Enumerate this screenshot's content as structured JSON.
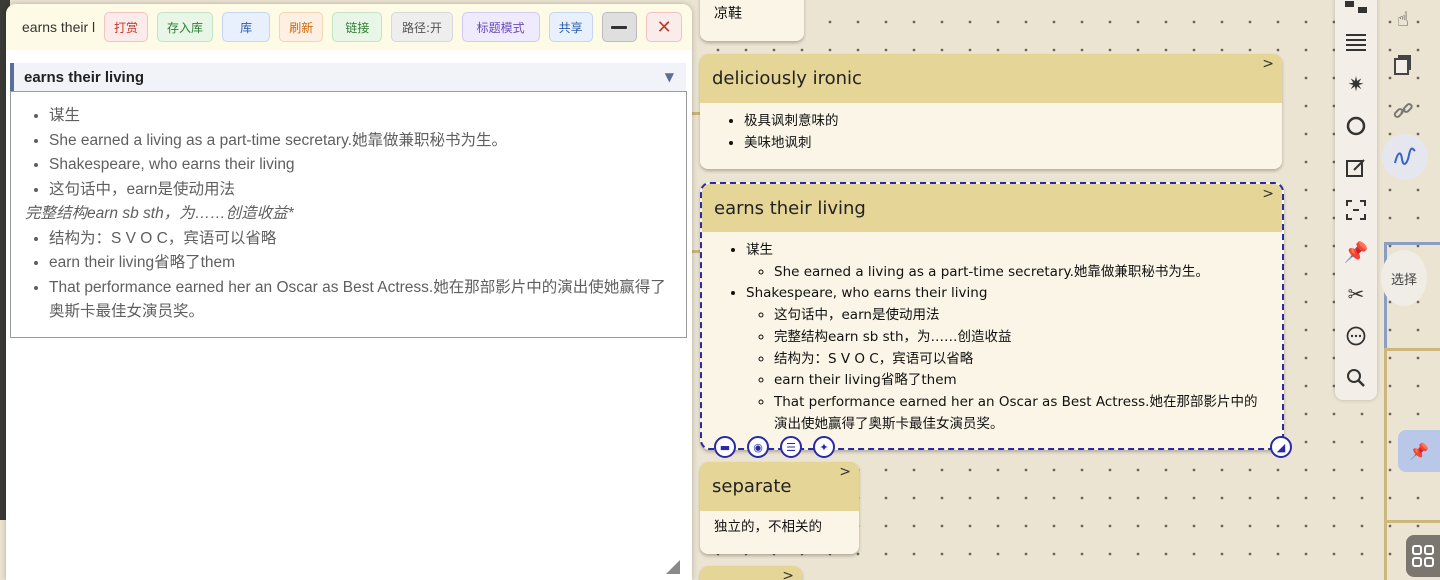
{
  "panel": {
    "title": "earns their l",
    "buttons": {
      "reward": "打赏",
      "save_to_library": "存入库",
      "library": "库",
      "refresh": "刷新",
      "link": "链接",
      "path": "路径:开",
      "title_mode": "标题模式",
      "share": "共享"
    },
    "topic_title": "earns their living",
    "toggle_symbol": "▼",
    "notes": [
      "谋生",
      "She earned a living as a part-time secretary.她靠做兼职秘书为生。",
      "Shakespeare, who earns their living",
      "这句话中，earn是使动用法"
    ],
    "italic_line": "完整结构earn sb sth，为……创造收益*",
    "notes_2": [
      "结构为：S V O C，宾语可以省略",
      "earn their living省略了them",
      "That performance earned her an Oscar as Best Actress.她在那部影片中的演出使她赢得了奥斯卡最佳女演员奖。"
    ]
  },
  "mindmap": {
    "card_top": {
      "text": "凉鞋"
    },
    "card_ironic": {
      "title": "deliciously ironic",
      "items": [
        "极具讽刺意味的",
        "美味地讽刺"
      ]
    },
    "card_earns": {
      "title": "earns their living",
      "item1": "谋生",
      "item1_sub": [
        "She earned a living as a part-time secretary.她靠做兼职秘书为生。"
      ],
      "item2": "Shakespeare, who earns their living",
      "item2_sub": [
        "这句话中，earn是使动用法",
        "完整结构earn sb sth，为……创造收益",
        "结构为：S V O C，宾语可以省略",
        "earn their living省略了them",
        "That performance earned her an Oscar as Best Actress.她在那部影片中的演出使她赢得了奥斯卡最佳女演员奖。"
      ]
    },
    "card_separate": {
      "title": "separate",
      "text": "独立的，不相关的"
    },
    "expand_symbol": ">"
  },
  "right_toolbar": {
    "icons": [
      "mindmap-icon",
      "menu-icon",
      "star-icon",
      "circle-icon",
      "edit-icon",
      "scan-icon",
      "pin-icon",
      "tools-icon",
      "chat-icon",
      "search-icon"
    ],
    "select_label": "选择"
  },
  "colors": {
    "card_header": "#e5d596",
    "card_body": "#faf5e6",
    "selection": "#2a2aa8",
    "topic_accent": "#5b6e95"
  }
}
